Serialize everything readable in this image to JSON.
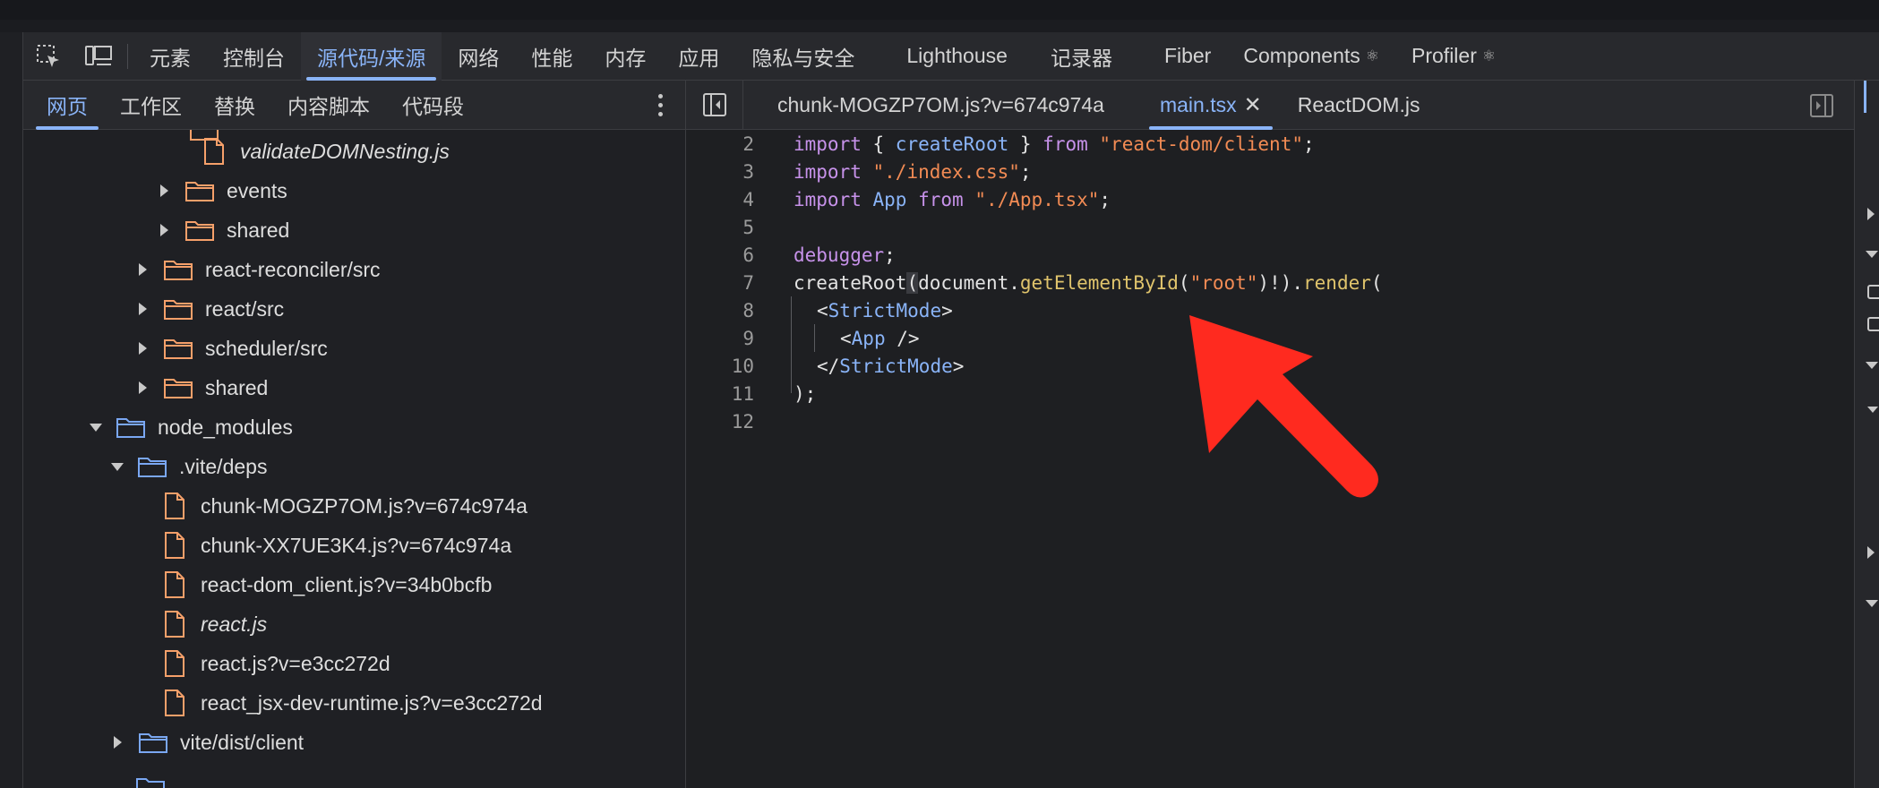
{
  "toolbar": {
    "inspect_icon": "element-picker-icon",
    "device_icon": "device-toolbar-icon",
    "tabs": [
      {
        "label": "元素"
      },
      {
        "label": "控制台"
      },
      {
        "label": "源代码/来源",
        "active": true
      },
      {
        "label": "网络"
      },
      {
        "label": "性能"
      },
      {
        "label": "内存"
      },
      {
        "label": "应用"
      },
      {
        "label": "隐私与安全"
      },
      {
        "label": "Lighthouse"
      },
      {
        "label": "记录器"
      },
      {
        "label": "Fiber"
      },
      {
        "label": "Components",
        "glyph": "⚛"
      },
      {
        "label": "Profiler",
        "glyph": "⚛"
      }
    ]
  },
  "navigator": {
    "tabs": [
      {
        "label": "网页",
        "active": true
      },
      {
        "label": "工作区"
      },
      {
        "label": "替换"
      },
      {
        "label": "内容脚本"
      },
      {
        "label": "代码段"
      }
    ],
    "tree": [
      {
        "label": "validateDOMNesting.js",
        "type": "file",
        "italic": true
      },
      {
        "label": "events",
        "type": "folder",
        "state": "collapsed"
      },
      {
        "label": "shared",
        "type": "folder",
        "state": "collapsed"
      },
      {
        "label": "react-reconciler/src",
        "type": "folder",
        "state": "collapsed"
      },
      {
        "label": "react/src",
        "type": "folder",
        "state": "collapsed"
      },
      {
        "label": "scheduler/src",
        "type": "folder",
        "state": "collapsed"
      },
      {
        "label": "shared",
        "type": "folder",
        "state": "collapsed"
      },
      {
        "label": "node_modules",
        "type": "folder",
        "state": "expanded"
      },
      {
        "label": ".vite/deps",
        "type": "folder",
        "state": "expanded"
      },
      {
        "label": "chunk-MOGZP7OM.js?v=674c974a",
        "type": "file"
      },
      {
        "label": "chunk-XX7UE3K4.js?v=674c974a",
        "type": "file"
      },
      {
        "label": "react-dom_client.js?v=34b0bcfb",
        "type": "file"
      },
      {
        "label": "react.js",
        "type": "file",
        "italic": true
      },
      {
        "label": "react.js?v=e3cc272d",
        "type": "file"
      },
      {
        "label": "react_jsx-dev-runtime.js?v=e3cc272d",
        "type": "file"
      },
      {
        "label": "vite/dist/client",
        "type": "folder",
        "state": "collapsed"
      }
    ]
  },
  "editor": {
    "tabs": [
      {
        "label": "chunk-MOGZP7OM.js?v=674c974a"
      },
      {
        "label": "main.tsx",
        "active": true,
        "closable": true
      },
      {
        "label": "ReactDOM.js"
      }
    ],
    "close_glyph": "✕",
    "line_numbers": [
      "2",
      "3",
      "4",
      "5",
      "6",
      "7",
      "8",
      "9",
      "10",
      "11",
      "12"
    ],
    "code": {
      "l2": {
        "a": "import",
        "b": " { ",
        "c": "createRoot",
        "d": " } ",
        "e": "from",
        "f": " ",
        "g": "\"react-dom/client\"",
        "h": ";"
      },
      "l3": {
        "a": "import",
        "b": " ",
        "c": "\"./index.css\"",
        "d": ";"
      },
      "l4": {
        "a": "import",
        "b": " ",
        "c": "App",
        "d": " ",
        "e": "from",
        "f": " ",
        "g": "\"./App.tsx\"",
        "h": ";"
      },
      "l6": {
        "a": "debugger",
        "b": ";"
      },
      "l7": {
        "a": "createRoot",
        "b": "(",
        "c": "document.",
        "d": "getElementById",
        "e": "(",
        "f": "\"root\"",
        "g": ")!)",
        "h": ".",
        "i": "render",
        "j": "("
      },
      "l8": {
        "a": "<",
        "b": "StrictMode",
        "c": ">"
      },
      "l9": {
        "a": "<",
        "b": "App",
        "c": " />"
      },
      "l10": {
        "a": "</",
        "b": "StrictMode",
        "c": ">"
      },
      "l11": {
        "a": ");"
      }
    }
  },
  "colors": {
    "accent": "#8ab4f8",
    "annotation_arrow": "#ff2a1f",
    "folder": "#f6a06a",
    "folder_blue": "#7aa7f2"
  }
}
